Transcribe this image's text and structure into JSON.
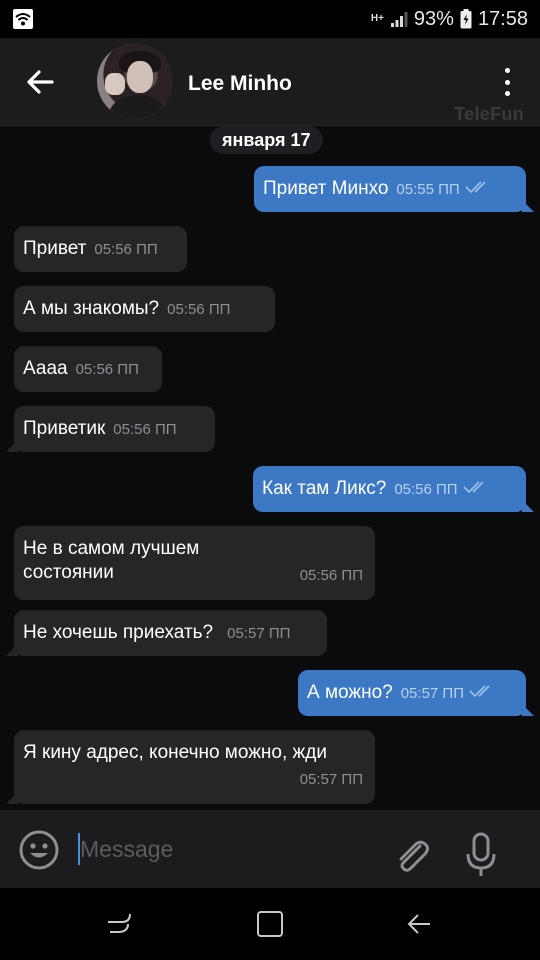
{
  "status_bar": {
    "network": "H+",
    "battery_percent": "93%",
    "time": "17:58"
  },
  "header": {
    "contact_name": "Lee Minho",
    "watermark": "TeleFun"
  },
  "chat": {
    "date": "января 17",
    "messages": [
      {
        "dir": "out",
        "text": "Привет Минхо",
        "time": "05:55 ПП",
        "read": true
      },
      {
        "dir": "in",
        "text": "Привет",
        "time": "05:56 ПП"
      },
      {
        "dir": "in",
        "text": "А мы знакомы?",
        "time": "05:56 ПП"
      },
      {
        "dir": "in",
        "text": "Аааа",
        "time": "05:56 ПП"
      },
      {
        "dir": "in",
        "text": "Приветик",
        "time": "05:56 ПП"
      },
      {
        "dir": "out",
        "text": "Как там Ликс?",
        "time": "05:56 ПП",
        "read": true
      },
      {
        "dir": "in",
        "text": "Не в самом лучшем состоянии",
        "time": "05:56 ПП"
      },
      {
        "dir": "in",
        "text": "Не хочешь приехать?",
        "time": "05:57 ПП"
      },
      {
        "dir": "out",
        "text": "А можно?",
        "time": "05:57 ПП",
        "read": true
      },
      {
        "dir": "in",
        "text": "Я кину адрес, конечно можно, жди",
        "time": "05:57 ПП"
      }
    ]
  },
  "composer": {
    "placeholder": "Message"
  },
  "colors": {
    "outgoing_bubble": "#3c78c4",
    "incoming_bubble": "#262629",
    "background": "#0b0b0d"
  }
}
